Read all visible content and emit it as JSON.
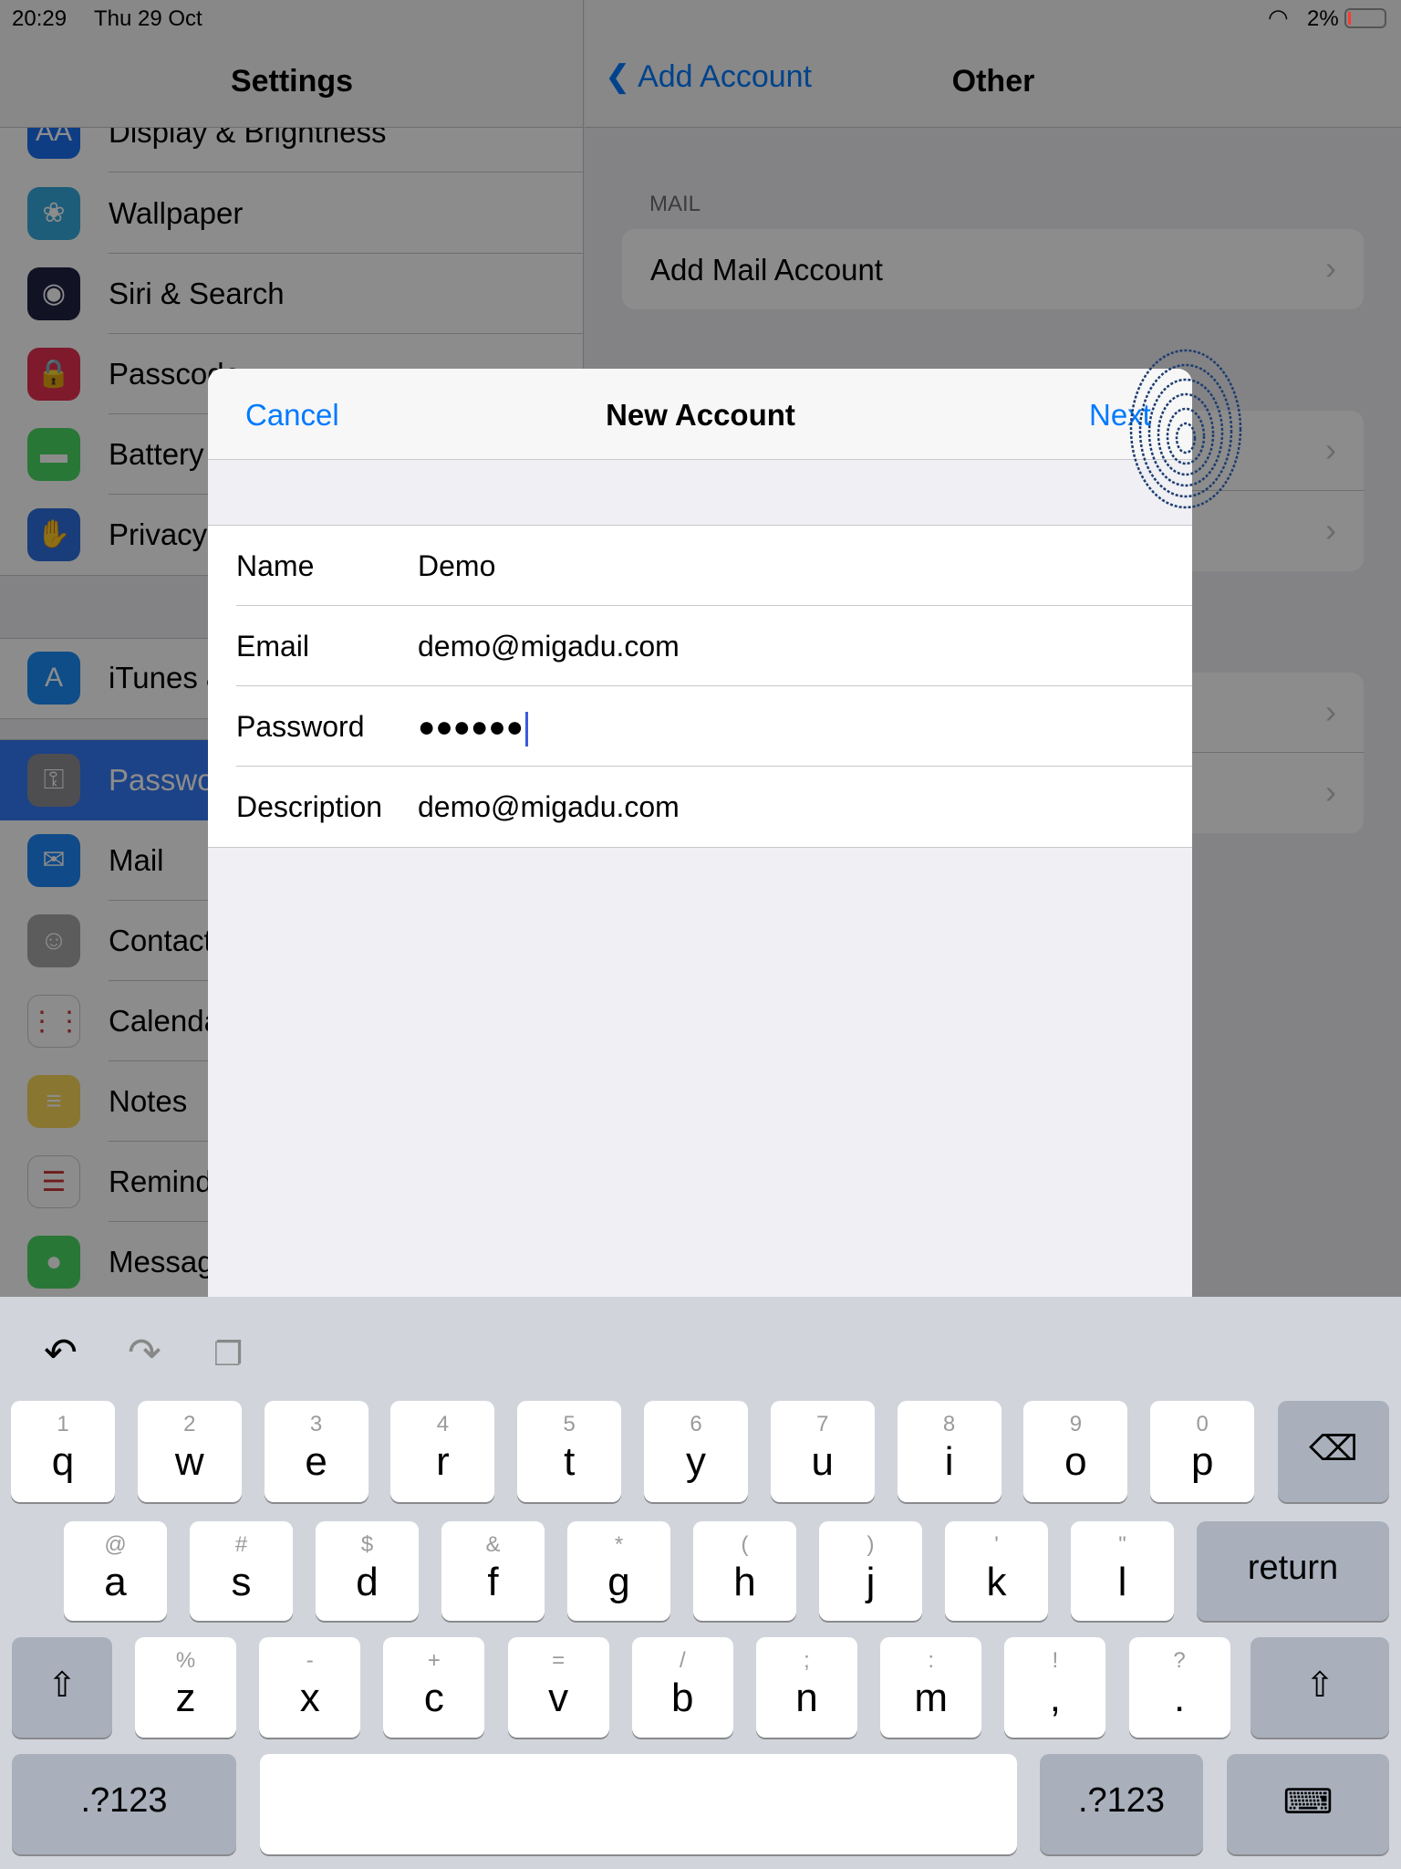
{
  "status": {
    "time": "20:29",
    "date": "Thu 29 Oct",
    "battery": "2%",
    "icons": [
      "wifi-icon",
      "battery-icon"
    ]
  },
  "sidebar": {
    "title": "Settings",
    "items": [
      {
        "label": "Display & Brightness",
        "icon": "display-icon",
        "color": "#1a6ff0",
        "glyph": "AA"
      },
      {
        "label": "Wallpaper",
        "icon": "wallpaper-icon",
        "color": "#35aadc",
        "glyph": "❀"
      },
      {
        "label": "Siri & Search",
        "icon": "siri-icon",
        "color": "#222244",
        "glyph": "◉"
      },
      {
        "label": "Passcode",
        "icon": "lock-icon",
        "color": "#e53150",
        "glyph": "🔒"
      },
      {
        "label": "Battery",
        "icon": "battery-icon",
        "color": "#4cd964",
        "glyph": "▬"
      },
      {
        "label": "Privacy",
        "icon": "hand-icon",
        "color": "#2f6fe0",
        "glyph": "✋"
      },
      {
        "label": "iTunes & App Store",
        "icon": "app-store-icon",
        "color": "#1a8cf8",
        "glyph": "A"
      },
      {
        "label": "Passwords & Accounts",
        "icon": "key-icon",
        "color": "#8e8e93",
        "glyph": "⚿",
        "selected": true
      },
      {
        "label": "Mail",
        "icon": "mail-icon",
        "color": "#1e88f8",
        "glyph": "✉"
      },
      {
        "label": "Contacts",
        "icon": "contacts-icon",
        "color": "#a8a8a8",
        "glyph": "☺"
      },
      {
        "label": "Calendar",
        "icon": "calendar-icon",
        "color": "#ffffff",
        "glyph": "⋮⋮"
      },
      {
        "label": "Notes",
        "icon": "notes-icon",
        "color": "#f7d85a",
        "glyph": "≡"
      },
      {
        "label": "Reminders",
        "icon": "reminders-icon",
        "color": "#ffffff",
        "glyph": "☰"
      },
      {
        "label": "Messages",
        "icon": "messages-icon",
        "color": "#4cd964",
        "glyph": "●"
      }
    ]
  },
  "detail": {
    "back": "Add Account",
    "title": "Other",
    "section": "MAIL",
    "add_mail": "Add Mail Account"
  },
  "modal": {
    "cancel": "Cancel",
    "title": "New Account",
    "next": "Next",
    "fields": [
      {
        "label": "Name",
        "value": "Demo"
      },
      {
        "label": "Email",
        "value": "demo@migadu.com"
      },
      {
        "label": "Password",
        "value": "●●●●●●"
      },
      {
        "label": "Description",
        "value": "demo@migadu.com"
      }
    ]
  },
  "keyboard": {
    "row1": [
      [
        "q",
        "1"
      ],
      [
        "w",
        "2"
      ],
      [
        "e",
        "3"
      ],
      [
        "r",
        "4"
      ],
      [
        "t",
        "5"
      ],
      [
        "y",
        "6"
      ],
      [
        "u",
        "7"
      ],
      [
        "i",
        "8"
      ],
      [
        "o",
        "9"
      ],
      [
        "p",
        "0"
      ]
    ],
    "row2": [
      [
        "a",
        "@"
      ],
      [
        "s",
        "#"
      ],
      [
        "d",
        "$"
      ],
      [
        "f",
        "&"
      ],
      [
        "g",
        "*"
      ],
      [
        "h",
        "("
      ],
      [
        "j",
        ")"
      ],
      [
        "k",
        "'"
      ],
      [
        "l",
        "\""
      ]
    ],
    "row3": [
      [
        "z",
        "%"
      ],
      [
        "x",
        "-"
      ],
      [
        "c",
        "+"
      ],
      [
        "v",
        "="
      ],
      [
        "b",
        "/"
      ],
      [
        "n",
        ";"
      ],
      [
        "m",
        ":"
      ],
      [
        ",",
        "!"
      ],
      [
        ".",
        "?"
      ]
    ],
    "return": "return",
    "numbers": ".?123",
    "numbers2": ".?123"
  }
}
